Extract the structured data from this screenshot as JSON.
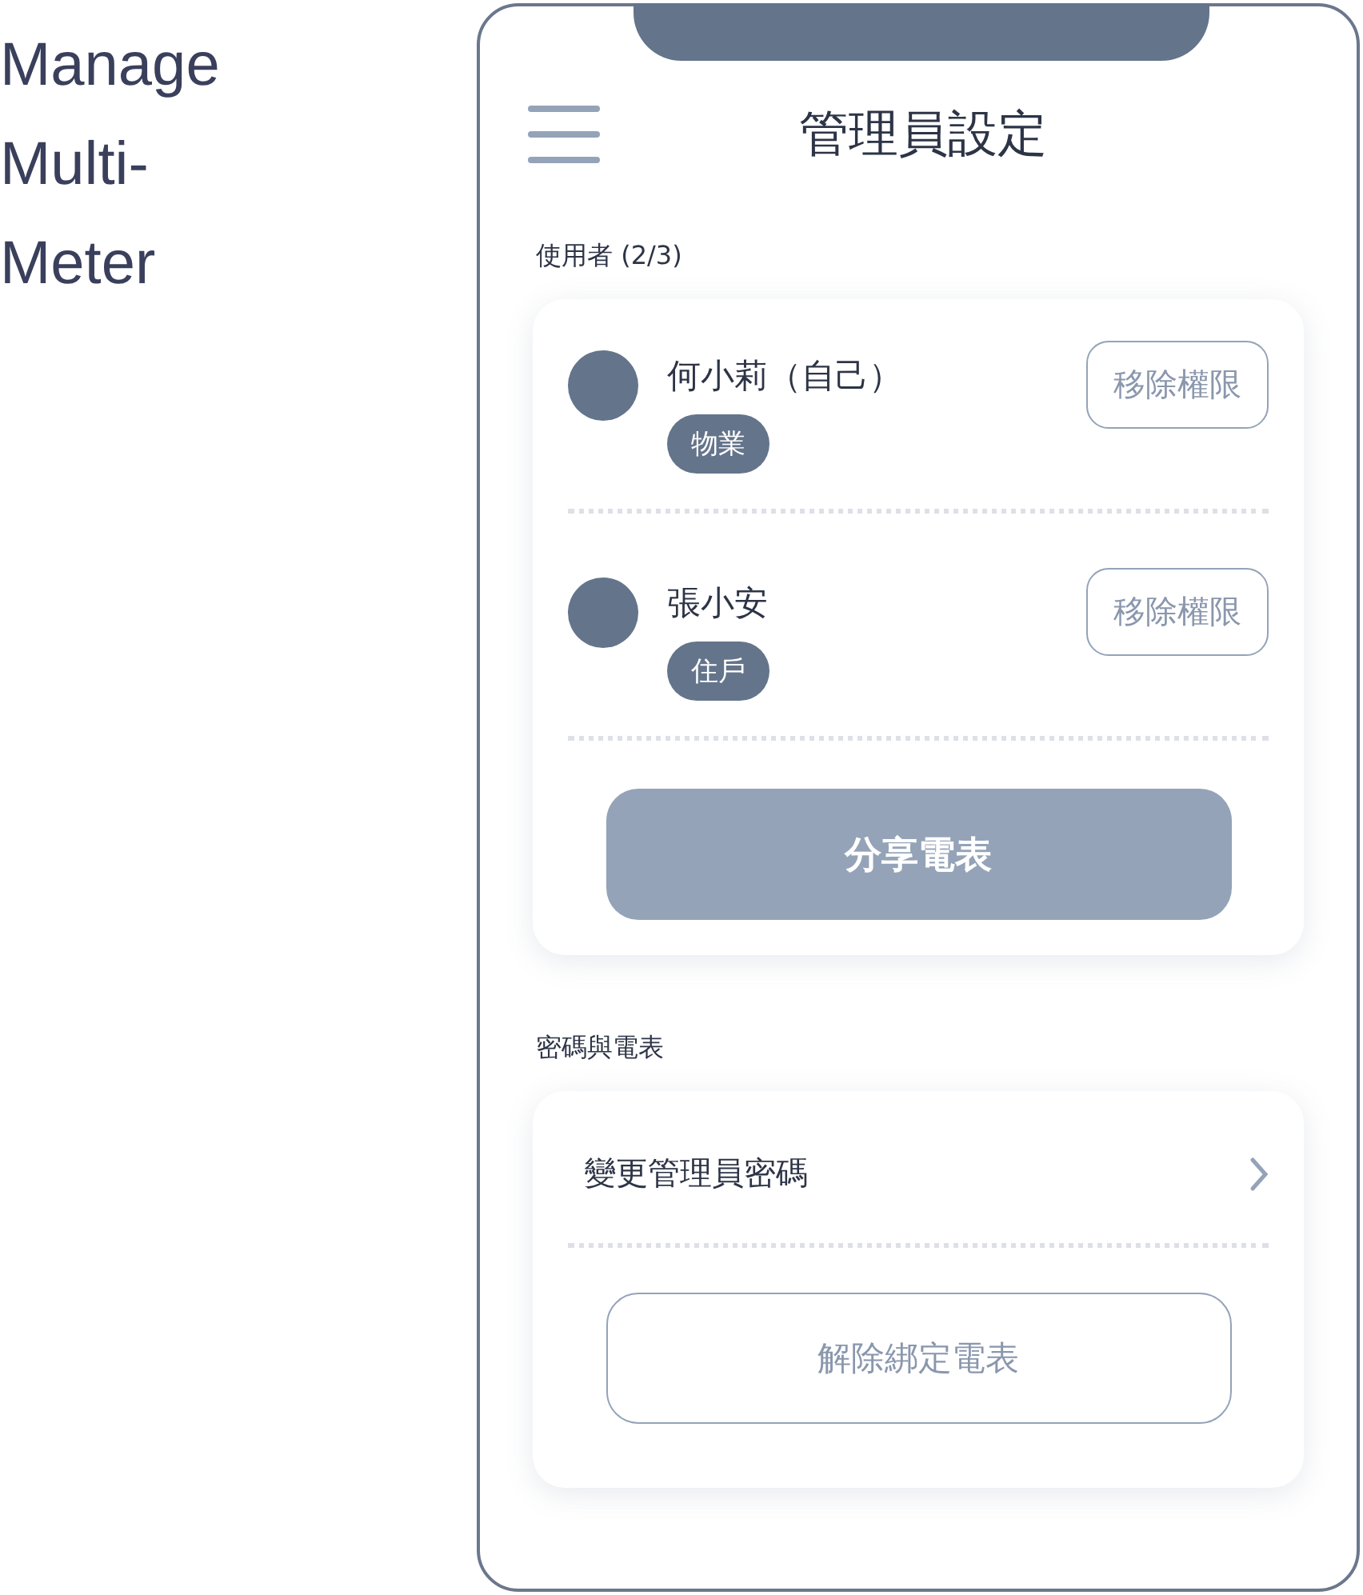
{
  "page_label": {
    "lines": [
      "Manage",
      "Multi-",
      "Meter"
    ]
  },
  "header": {
    "title": "管理員設定"
  },
  "users_section": {
    "label": "使用者 (2/3)",
    "users": [
      {
        "name": "何小莉（自己）",
        "role": "物業",
        "action": "移除權限"
      },
      {
        "name": "張小安",
        "role": "住戶",
        "action": "移除權限"
      }
    ],
    "share_button": "分享電表"
  },
  "meter_section": {
    "label": "密碼與電表",
    "menu_item": "變更管理員密碼",
    "unbind_button": "解除綁定電表"
  }
}
